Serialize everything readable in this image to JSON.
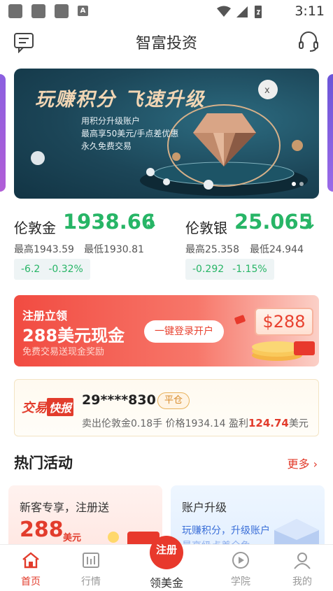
{
  "status_bar": {
    "time": "3:11"
  },
  "header": {
    "title": "智富投资",
    "left_icon": "message-icon",
    "right_icon": "headset-icon"
  },
  "banner": {
    "title": "玩赚积分 飞速升级",
    "lines": [
      "用积分升级账户",
      "最高享50美元/手点差优惠",
      "永久免费交易"
    ],
    "dots": 2,
    "active_dot": 0
  },
  "quotes": [
    {
      "name": "伦敦金",
      "price": "1938.66",
      "high": "最高1943.59",
      "low": "最低1930.81",
      "change": "-6.2",
      "change_pct": "-0.32%"
    },
    {
      "name": "伦敦银",
      "price": "25.065",
      "high": "最高25.358",
      "low": "最低24.944",
      "change": "-0.292",
      "change_pct": "-1.15%"
    }
  ],
  "colors": {
    "down": "#27b566",
    "accent": "#e23c2c"
  },
  "promo": {
    "line1": "注册立领",
    "line2": "288美元现金",
    "line3": "免费交易送现金奖励",
    "button": "一键登录开户",
    "coupon": "$288"
  },
  "trade": {
    "logo_a": "交易",
    "logo_b": "快报",
    "user": "29****830",
    "badge": "平仓",
    "detail_prefix": "卖出伦敦金0.18手 价格1934.14 盈利",
    "profit": "124.74",
    "unit": "美元"
  },
  "activities": {
    "title": "热门活动",
    "more": "更多",
    "card1": {
      "title": "新客专享，注册送",
      "big": "288",
      "unit": "美元"
    },
    "card2": {
      "title": "账户升级",
      "sub": "玩赚积分，升级账户",
      "sub2": "最高级点差全免"
    }
  },
  "tabbar": {
    "items": [
      {
        "label": "首页",
        "icon": "home-icon"
      },
      {
        "label": "行情",
        "icon": "chart-icon"
      },
      {
        "label": "领美金",
        "icon": "register-icon",
        "badge": "注册"
      },
      {
        "label": "学院",
        "icon": "play-icon"
      },
      {
        "label": "我的",
        "icon": "user-icon"
      }
    ]
  }
}
